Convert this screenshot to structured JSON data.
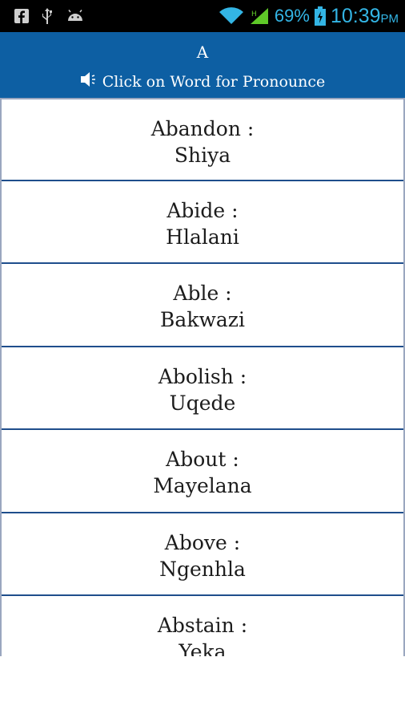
{
  "status_bar": {
    "battery": "69%",
    "time": "10:39",
    "ampm": "PM",
    "icons": [
      "facebook-icon",
      "usb-icon",
      "android-icon",
      "wifi-icon",
      "signal-icon",
      "battery-icon"
    ]
  },
  "header": {
    "letter": "A",
    "hint": "Click on Word for Pronounce",
    "background": "#0d5fa3"
  },
  "words": [
    {
      "word": "Abandon :",
      "translation": "Shiya"
    },
    {
      "word": "Abide :",
      "translation": "Hlalani"
    },
    {
      "word": "Able :",
      "translation": "Bakwazi"
    },
    {
      "word": "Abolish :",
      "translation": "Uqede"
    },
    {
      "word": "About :",
      "translation": "Mayelana"
    },
    {
      "word": "Above :",
      "translation": "Ngenhla"
    },
    {
      "word": "Abstain :",
      "translation": "Yeka"
    }
  ]
}
